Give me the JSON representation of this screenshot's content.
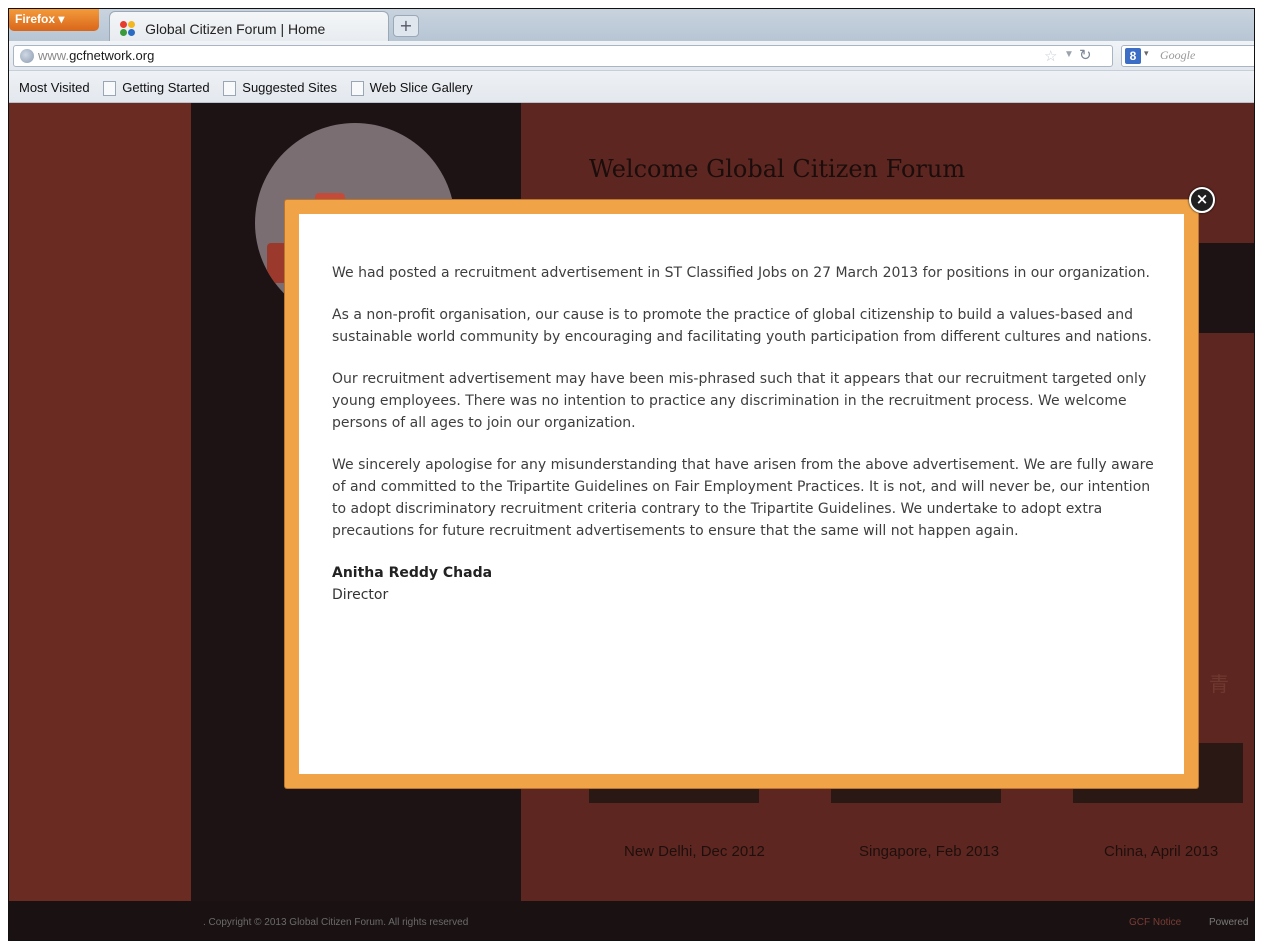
{
  "browser": {
    "menu_button": "Firefox",
    "tab_title": "Global Citizen Forum | Home",
    "new_tab": "+",
    "url_prefix": "www.",
    "url_domain": "gcfnetwork.org",
    "search_placeholder": "Google",
    "search_engine_icon": "8",
    "bookmarks": [
      "Most Visited",
      "Getting Started",
      "Suggested Sites",
      "Web Slice Gallery"
    ]
  },
  "page": {
    "welcome": "Welcome Global Citizen Forum",
    "captions": [
      "New Delhi, Dec 2012",
      "Singapore, Feb 2013",
      "China, April 2013"
    ],
    "footer_copyright": ". Copyright © 2013 Global Citizen Forum. All rights reserved",
    "footer_notice": "GCF Notice",
    "footer_powered": "Powered"
  },
  "modal": {
    "close_label": "×",
    "paragraphs": [
      "We had posted a recruitment advertisement in ST Classified Jobs on 27 March 2013 for positions in our organization.",
      "As a non-profit organisation, our cause is to promote the practice of global citizenship to build a values-based and sustainable world community by encouraging and facilitating youth participation from different cultures and nations.",
      "Our recruitment advertisement may have been mis-phrased such that it appears that our recruitment targeted only young employees. There was no intention to practice any discrimination in the recruitment process. We welcome persons of all ages to join our organization.",
      "We sincerely apologise for any misunderstanding that have arisen from the above advertisement. We are fully aware of and committed to the Tripartite Guidelines on Fair Employment Practices. It is not, and will never be, our intention to adopt discriminatory recruitment criteria contrary to the Tripartite Guidelines. We undertake to adopt extra precautions for future recruitment advertisements to ensure that the same will not happen again."
    ],
    "signature_name": "Anitha Reddy Chada",
    "signature_title": "Director"
  },
  "colors": {
    "modal_border": "#f0a447",
    "page_background": "#5e2620",
    "firefox_orange": "#e5782a"
  }
}
